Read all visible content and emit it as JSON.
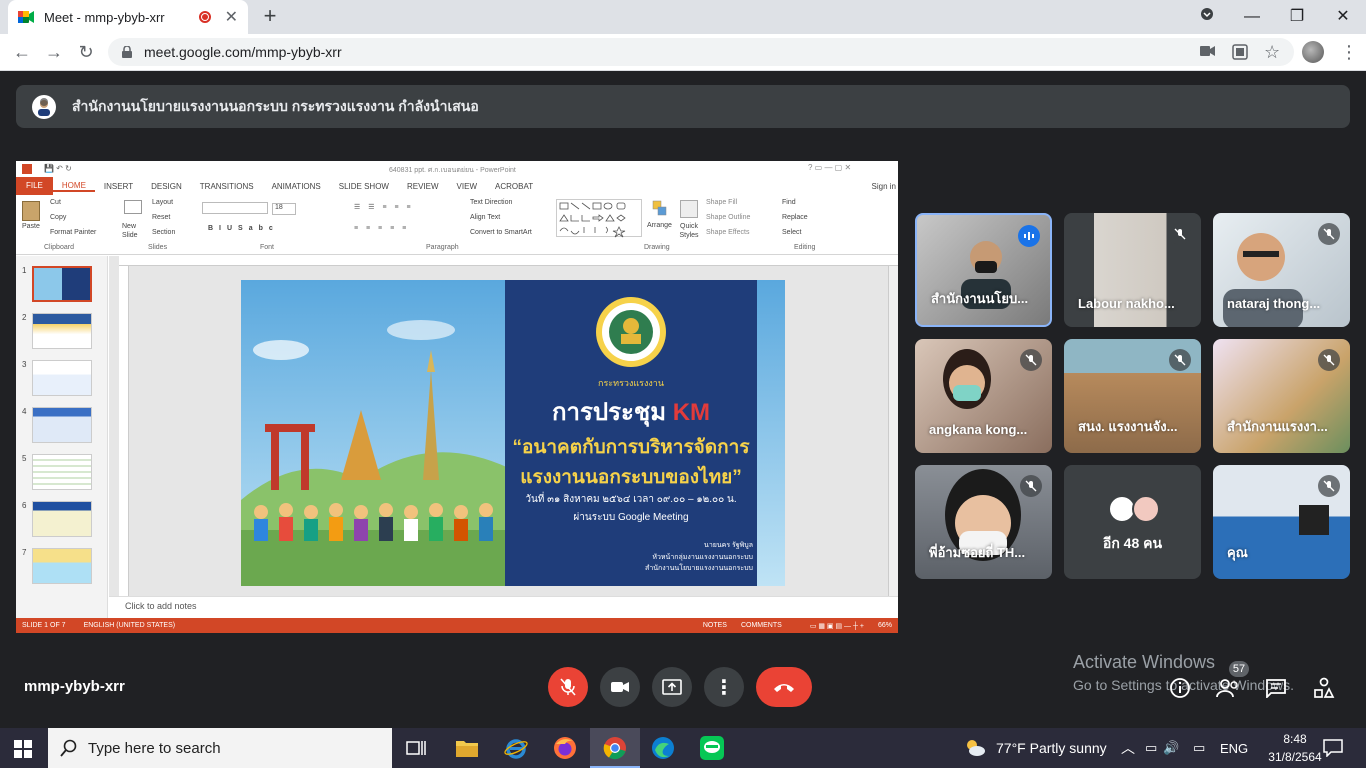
{
  "browser": {
    "tab_title": "Meet - mmp-ybyb-xrr",
    "url": "meet.google.com/mmp-ybyb-xrr"
  },
  "banner": {
    "text": "สำนักงานนโยบายแรงงานนอกระบบ กระทรวงแรงงาน กำลังนำเสนอ"
  },
  "ppt": {
    "window_title": "640831 ppt. ศ.ก.เบอนตย่ยน - PowerPoint",
    "sign_in": "Sign in",
    "tabs": [
      "FILE",
      "HOME",
      "INSERT",
      "DESIGN",
      "TRANSITIONS",
      "ANIMATIONS",
      "SLIDE SHOW",
      "REVIEW",
      "VIEW",
      "ACROBAT"
    ],
    "ribbon": {
      "paste": "Paste",
      "cut": "Cut",
      "copy": "Copy",
      "format_painter": "Format Painter",
      "clipboard": "Clipboard",
      "new_slide": "New Slide",
      "layout": "Layout",
      "reset": "Reset",
      "section": "Section",
      "slides": "Slides",
      "font_size": "18",
      "font": "Font",
      "text_direction": "Text Direction",
      "align_text": "Align Text",
      "convert_smartart": "Convert to SmartArt",
      "paragraph": "Paragraph",
      "arrange": "Arrange",
      "quick_styles": "Quick Styles",
      "shape_fill": "Shape Fill",
      "shape_outline": "Shape Outline",
      "shape_effects": "Shape Effects",
      "drawing": "Drawing",
      "find": "Find",
      "replace": "Replace",
      "select": "Select",
      "editing": "Editing"
    },
    "thumb_numbers": [
      "1",
      "2",
      "3",
      "4",
      "5",
      "6",
      "7"
    ],
    "slide": {
      "title_prefix": "การประชุม ",
      "title_km": "KM",
      "line1": "“อนาคตกับการบริหารจัดการ",
      "line2": "แรงงานนอกระบบของไทย”",
      "date": "วันที่ ๓๑ สิงหาคม ๒๕๖๔ เวลา ๐๙.๐๐ – ๑๒.๐๐ น.",
      "via": "ผ่านระบบ Google Meeting",
      "logo_text": "กระทรวงแรงงาน",
      "presenter": "นายนคร  รัฐพิบูล",
      "position": "หัวหน้ากลุ่มงานแรงงานนอกระบบ",
      "office": "สำนักงานนโยบายแรงงานนอกระบบ"
    },
    "notes": "Click to add notes",
    "status": {
      "slide": "SLIDE 1 OF 7",
      "lang": "ENGLISH (UNITED STATES)",
      "notes": "NOTES",
      "comments": "COMMENTS",
      "zoom": "66%"
    }
  },
  "participants": [
    {
      "name": "สำนักงานนโยบ..."
    },
    {
      "name": "Labour nakho..."
    },
    {
      "name": "nataraj thong..."
    },
    {
      "name": "angkana kong..."
    },
    {
      "name": "สนง. แรงงานจัง..."
    },
    {
      "name": "สำนักงานแรงงา..."
    },
    {
      "name": "พี่อ้ามซอยถี่ TH..."
    },
    {
      "name": "อีก 48 คน"
    },
    {
      "name": "คุณ"
    }
  ],
  "bottom": {
    "meeting_code": "mmp-ybyb-xrr",
    "people_count": "57",
    "activate_title": "Activate Windows",
    "activate_sub": "Go to Settings to activate Windows."
  },
  "taskbar": {
    "search_placeholder": "Type here to search",
    "weather": "77°F  Partly sunny",
    "lang": "ENG",
    "time": "8:48",
    "date": "31/8/2564"
  }
}
